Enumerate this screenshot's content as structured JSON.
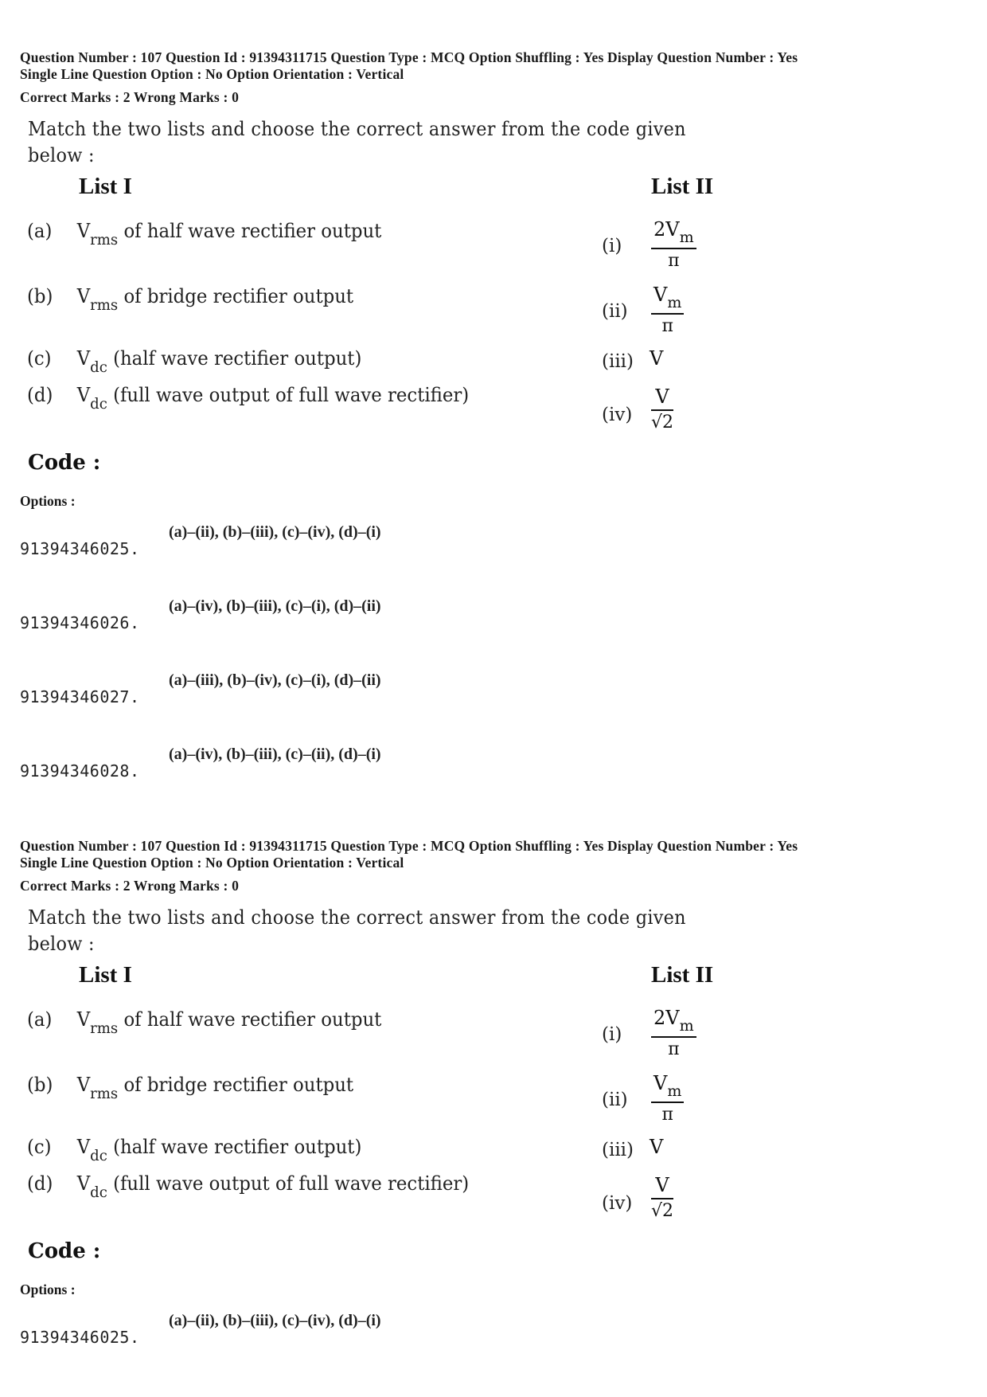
{
  "question": {
    "meta_line1": "Question Number : 107  Question Id : 91394311715  Question Type : MCQ  Option Shuffling : Yes  Display Question Number : Yes",
    "meta_line2": "Single Line Question Option : No  Option Orientation : Vertical",
    "marks_line": "Correct Marks : 2  Wrong Marks : 0",
    "stem_line1": "Match the two lists and choose the correct answer from the code given",
    "stem_line2": "below :",
    "list1_title": "List I",
    "list2_title": "List II",
    "list1": [
      {
        "label": "(a)",
        "symbol": "V",
        "sub": "rms",
        "text": " of half wave rectifier output"
      },
      {
        "label": "(b)",
        "symbol": "V",
        "sub": "rms",
        "text": " of bridge rectifier output"
      },
      {
        "label": "(c)",
        "symbol": "V",
        "sub": "dc",
        "text": " (half wave rectifier output)"
      },
      {
        "label": "(d)",
        "symbol": "V",
        "sub": "dc",
        "text": " (full wave output of full wave rectifier)"
      }
    ],
    "list2": [
      {
        "label": "(i)",
        "num": "2V",
        "num_sub": "m",
        "den": "π"
      },
      {
        "label": "(ii)",
        "num": "V",
        "num_sub": "m",
        "den": "π"
      },
      {
        "label": "(iii)",
        "value": "V"
      },
      {
        "label": "(iv)",
        "num": "V",
        "num_sub": "",
        "den": "√2"
      }
    ],
    "code_title": "Code :",
    "options_label": "Options :",
    "options": [
      {
        "id": "91394346025.",
        "text": "(a)–(ii), (b)–(iii), (c)–(iv), (d)–(i)"
      },
      {
        "id": "91394346026.",
        "text": "(a)–(iv), (b)–(iii), (c)–(i), (d)–(ii)"
      },
      {
        "id": "91394346027.",
        "text": "(a)–(iii), (b)–(iv), (c)–(i), (d)–(ii)"
      },
      {
        "id": "91394346028.",
        "text": "(a)–(iv), (b)–(iii), (c)–(ii), (d)–(i)"
      }
    ]
  }
}
